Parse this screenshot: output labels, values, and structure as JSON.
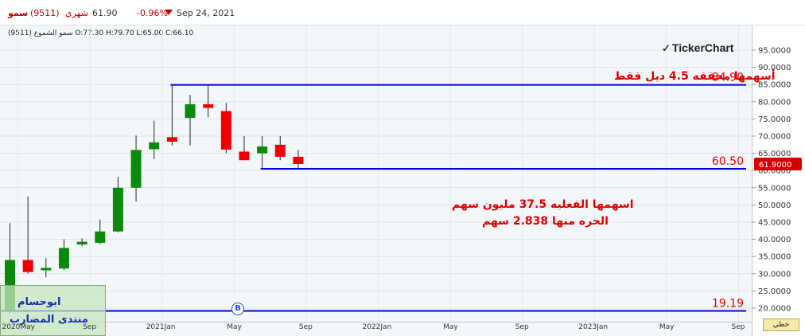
{
  "header": {
    "name": "سمو",
    "code": "(9511)",
    "period": "شهري",
    "price": "61.90",
    "change": "-0.96%",
    "date": "Sep 24, 2021"
  },
  "ohlc_label": "سمو الشموع (9511) O:77.30 H:79.70 L:65.00 C:66.10",
  "logo": "TickerChart",
  "scale_button": "خطي",
  "marker_label": "B",
  "annotations": {
    "top": "أسهمها محققه 4.5 ديل فقط",
    "middle_line1": "اسهمها الفعليه 37.5 مليون سهم",
    "middle_line2": "الحره منها 2.838 سهم"
  },
  "note": {
    "line1": "ابوحسام",
    "line2": "منتدى المضارب"
  },
  "colors": {
    "up": "#0a8a0a",
    "down": "#ee0000",
    "line": "#0000dd",
    "text_red": "#e00000",
    "price_badge": "#d40000"
  },
  "chart_data": {
    "type": "candlestick",
    "ylim": [
      17.5,
      97.5
    ],
    "y_ticks": [
      "20.0000",
      "25.0000",
      "30.0000",
      "35.0000",
      "40.0000",
      "45.0000",
      "50.0000",
      "55.0000",
      "60.0000",
      "65.0000",
      "70.0000",
      "75.0000",
      "80.0000",
      "85.0000",
      "90.0000",
      "95.0000"
    ],
    "x_labels": [
      "2020May",
      "Sep",
      "2021Jan",
      "May",
      "Sep",
      "2022Jan",
      "May",
      "Sep",
      "2023Jan",
      "May",
      "Sep"
    ],
    "last_price": "61.9000",
    "candles": [
      {
        "date": "2020-05",
        "open": 19.0,
        "high": 44.7,
        "low": 18.5,
        "close": 34.0
      },
      {
        "date": "2020-06",
        "open": 34.0,
        "high": 52.5,
        "low": 30.0,
        "close": 30.5
      },
      {
        "date": "2020-07",
        "open": 31.0,
        "high": 34.5,
        "low": 29.0,
        "close": 31.7
      },
      {
        "date": "2020-08",
        "open": 31.5,
        "high": 40.0,
        "low": 31.0,
        "close": 37.5
      },
      {
        "date": "2020-09",
        "open": 38.5,
        "high": 40.3,
        "low": 38.0,
        "close": 39.3
      },
      {
        "date": "2020-10",
        "open": 39.0,
        "high": 45.8,
        "low": 38.5,
        "close": 42.3
      },
      {
        "date": "2020-11",
        "open": 42.3,
        "high": 58.2,
        "low": 42.0,
        "close": 55.0
      },
      {
        "date": "2020-12",
        "open": 55.0,
        "high": 70.2,
        "low": 51.0,
        "close": 66.0
      },
      {
        "date": "2021-01",
        "open": 66.2,
        "high": 74.5,
        "low": 63.3,
        "close": 68.2
      },
      {
        "date": "2021-02",
        "open": 69.7,
        "high": 84.9,
        "low": 67.3,
        "close": 68.4
      },
      {
        "date": "2021-03",
        "open": 75.3,
        "high": 82.0,
        "low": 67.3,
        "close": 79.3
      },
      {
        "date": "2021-04",
        "open": 79.3,
        "high": 84.9,
        "low": 75.5,
        "close": 78.2
      },
      {
        "date": "2021-05",
        "open": 77.3,
        "high": 79.7,
        "low": 65.0,
        "close": 66.1
      },
      {
        "date": "2021-06",
        "open": 65.5,
        "high": 70.0,
        "low": 63.5,
        "close": 63.0
      },
      {
        "date": "2021-07",
        "open": 65.0,
        "high": 70.0,
        "low": 60.5,
        "close": 67.0
      },
      {
        "date": "2021-08",
        "open": 67.5,
        "high": 70.0,
        "low": 63.0,
        "close": 64.0
      },
      {
        "date": "2021-09",
        "open": 64.0,
        "high": 66.0,
        "low": 60.5,
        "close": 61.9
      }
    ],
    "hlines": [
      {
        "value": 84.9,
        "label": "84.90",
        "from": "2021-02",
        "to": "end"
      },
      {
        "value": 60.5,
        "label": "60.50",
        "from": "2021-07",
        "to": "end"
      },
      {
        "value": 19.19,
        "label": "19.19",
        "from": "start",
        "to": "end"
      }
    ]
  }
}
